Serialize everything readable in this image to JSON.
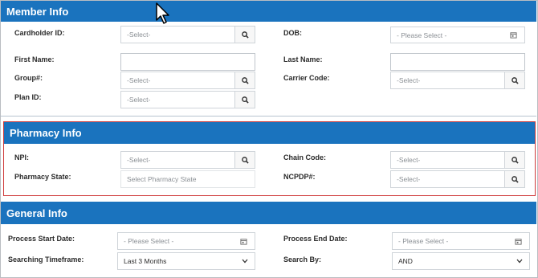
{
  "member": {
    "title": "Member Info",
    "cardholder_label": "Cardholder ID:",
    "cardholder_value": "-Select-",
    "dob_label": "DOB:",
    "dob_placeholder": "- Please Select -",
    "first_name_label": "First Name:",
    "last_name_label": "Last Name:",
    "group_label": "Group#:",
    "group_value": "-Select-",
    "carrier_label": "Carrier Code:",
    "carrier_value": "-Select-",
    "plan_label": "Plan ID:",
    "plan_value": "-Select-"
  },
  "pharmacy": {
    "title": "Pharmacy Info",
    "npi_label": "NPI:",
    "npi_value": "-Select-",
    "chain_label": "Chain Code:",
    "chain_value": "-Select-",
    "state_label": "Pharmacy State:",
    "state_placeholder": "Select Pharmacy State",
    "ncpdp_label": "NCPDP#:",
    "ncpdp_value": "-Select-"
  },
  "general": {
    "title": "General Info",
    "start_label": "Process Start Date:",
    "start_placeholder": "- Please Select -",
    "end_label": "Process End Date:",
    "end_placeholder": "- Please Select -",
    "timeframe_label": "Searching Timeframe:",
    "timeframe_value": "Last 3 Months",
    "searchby_label": "Search By:",
    "searchby_value": "AND"
  },
  "icons": {
    "search": "magnifier-icon",
    "calendar": "calendar-icon",
    "chevron": "chevron-down-icon",
    "cursor": "mouse-pointer-icon"
  },
  "colors": {
    "header_bg": "#1a73be",
    "highlight_border": "#cf3b3b"
  }
}
